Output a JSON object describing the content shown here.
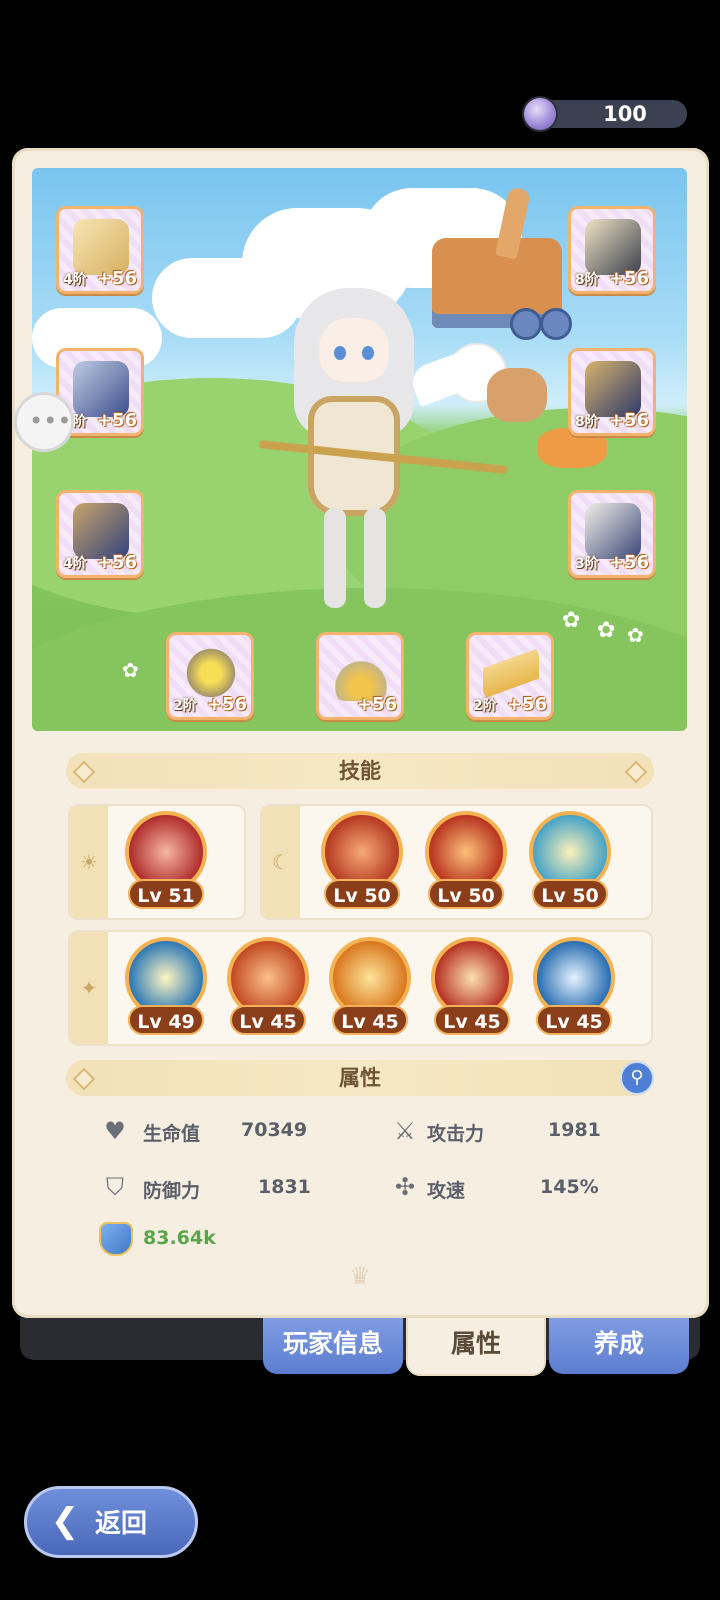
{
  "currency": {
    "icon": "purple-gem-icon",
    "value": "100"
  },
  "equipment": [
    {
      "slot": "bow",
      "tier": "4阶",
      "plus": "+56"
    },
    {
      "slot": "armor",
      "tier": "8阶",
      "plus": "+56"
    },
    {
      "slot": "pants",
      "tier": "4阶",
      "plus": "+56"
    },
    {
      "slot": "helmet",
      "tier": "8阶",
      "plus": "+56"
    },
    {
      "slot": "gloves",
      "tier": "8阶",
      "plus": "+56"
    },
    {
      "slot": "boots",
      "tier": "3阶",
      "plus": "+56"
    },
    {
      "slot": "ring",
      "tier": "2阶",
      "plus": "+56"
    },
    {
      "slot": "necklace",
      "tier": "",
      "plus": "+56"
    },
    {
      "slot": "charm",
      "tier": "2阶",
      "plus": "+56"
    }
  ],
  "skills_title": "技能",
  "skills": {
    "sun": [
      {
        "level": "Lv 51"
      }
    ],
    "moon": [
      {
        "level": "Lv 50"
      },
      {
        "level": "Lv 50"
      },
      {
        "level": "Lv 50"
      }
    ],
    "star": [
      {
        "level": "Lv 49"
      },
      {
        "level": "Lv 45"
      },
      {
        "level": "Lv 45"
      },
      {
        "level": "Lv 45"
      },
      {
        "level": "Lv 45"
      }
    ]
  },
  "attributes_title": "属性",
  "stats": {
    "hp": {
      "label": "生命值",
      "value": "70349"
    },
    "atk": {
      "label": "攻击力",
      "value": "1981"
    },
    "def": {
      "label": "防御力",
      "value": "1831"
    },
    "spd": {
      "label": "攻速",
      "value": "145%"
    },
    "power": {
      "value": "83.64k"
    }
  },
  "tabs": {
    "player_info": "玩家信息",
    "attributes": "属性",
    "cultivate": "养成"
  },
  "back_label": "返回"
}
